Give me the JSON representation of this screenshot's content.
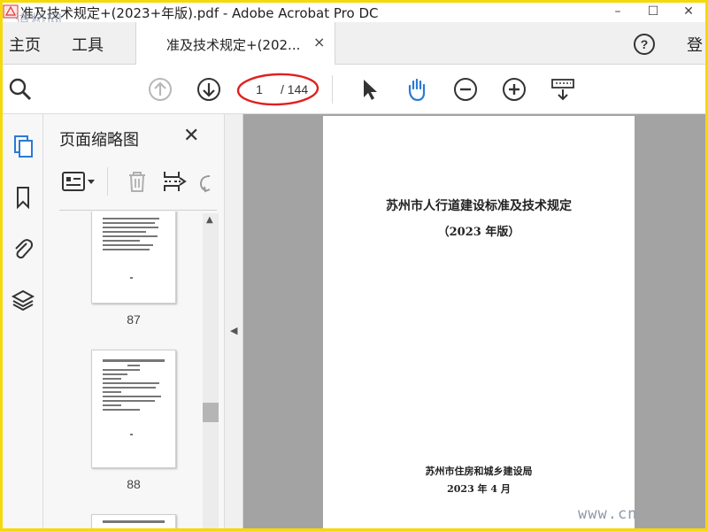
{
  "window": {
    "title": "准及技术规定+(2023+年版).pdf - Adobe Acrobat Pro DC",
    "watermark": "道桥网"
  },
  "menu": {
    "home": "主页",
    "tools": "工具",
    "doc_tab": "准及技术规定+(202...",
    "close_tab": "×",
    "login": "登"
  },
  "toolbar": {
    "page_current": "1",
    "page_total": "/ 144",
    "icons": [
      "search-icon",
      "page-up-icon",
      "page-down-icon",
      "select-arrow-icon",
      "hand-icon",
      "zoom-out-icon",
      "zoom-in-icon",
      "keyboard-icon"
    ]
  },
  "sidebar": {
    "title": "页面缩略图",
    "close": "✕",
    "thumbnails": [
      {
        "page": "87"
      },
      {
        "page": "88"
      }
    ]
  },
  "document": {
    "title": "苏州市人行道建设标准及技术规定",
    "subtitle": "（2023 年版）",
    "issuer": "苏州市住房和城乡建设局",
    "date": "2023 年 4 月"
  },
  "footer_watermark": "www.cn",
  "colors": {
    "frame": "#f5d90a",
    "accent_blue": "#2a7ad6",
    "doc_bg": "#a3a3a3",
    "annotation_red": "#e02020"
  }
}
